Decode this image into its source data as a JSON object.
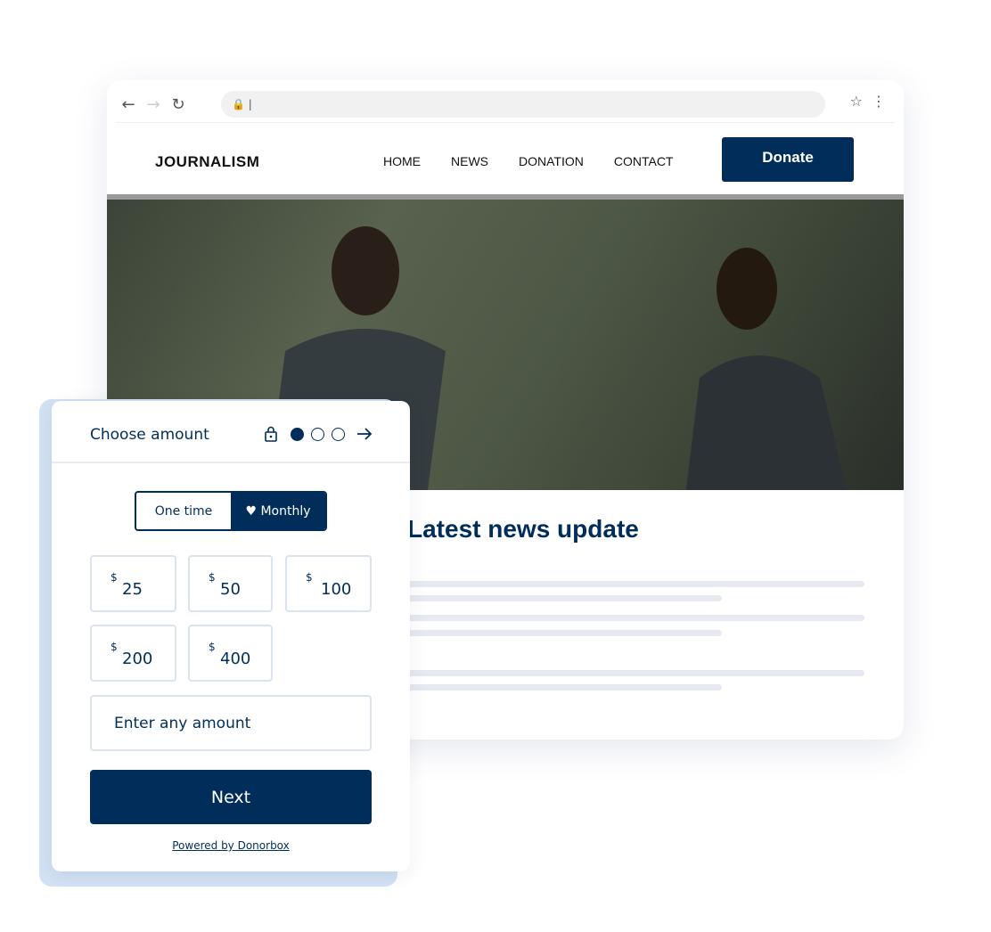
{
  "browser": {
    "icons": [
      "back-arrow-icon",
      "forward-arrow-icon",
      "reload-icon",
      "lock-icon",
      "star-icon",
      "kebab-menu-icon"
    ]
  },
  "site": {
    "logo": "JOURNALISM",
    "nav": [
      "HOME",
      "NEWS",
      "DONATION",
      "CONTACT"
    ],
    "donate_label": "Donate",
    "headline": "Latest news update"
  },
  "widget": {
    "title": "Choose amount",
    "step_current": 1,
    "step_total": 3,
    "frequency": {
      "options": [
        "One time",
        "Monthly"
      ],
      "selected": "Monthly"
    },
    "currency": "$",
    "amounts": [
      "25",
      "50",
      "100",
      "200",
      "400"
    ],
    "custom_placeholder": "Enter any amount",
    "next_label": "Next",
    "powered_by": "Powered by Donorbox"
  },
  "colors": {
    "brand": "#002d5a",
    "shadow": "#d2e1f3"
  }
}
